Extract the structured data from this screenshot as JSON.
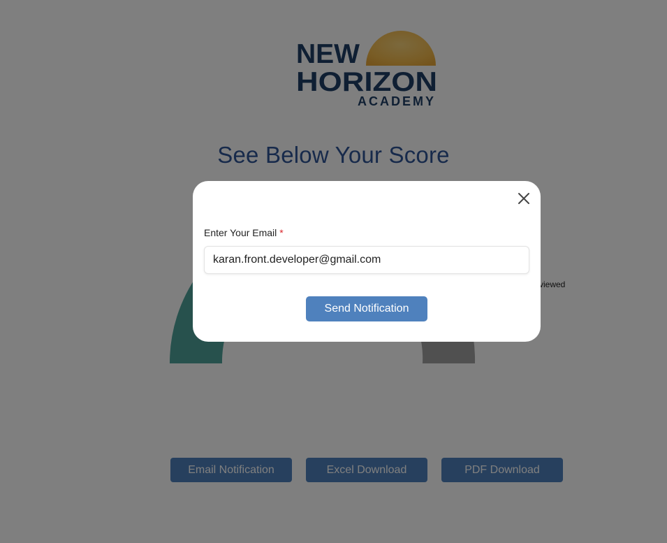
{
  "logo": {
    "line1": "NEW",
    "line2": "HORIZON",
    "line3": "ACADEMY"
  },
  "page": {
    "title": "See Below Your Score"
  },
  "gauge": {
    "legend_label": "viewed"
  },
  "actions": {
    "email_notification": "Email Notification",
    "excel_download": "Excel Download",
    "pdf_download": "PDF Download"
  },
  "modal": {
    "field_label": "Enter Your Email",
    "required_mark": "*",
    "email_value": "karan.front.developer@gmail.com",
    "send_label": "Send Notification",
    "close_icon": "close-icon"
  },
  "colors": {
    "brand_navy": "#1f3f66",
    "sun": "#f2b94b",
    "title_blue": "#2f5597",
    "button_blue": "#4f81bd",
    "gauge_teal": "#4fa39a",
    "gauge_gray": "#a0a0a0",
    "overlay": "rgba(0,0,0,0.5)"
  }
}
